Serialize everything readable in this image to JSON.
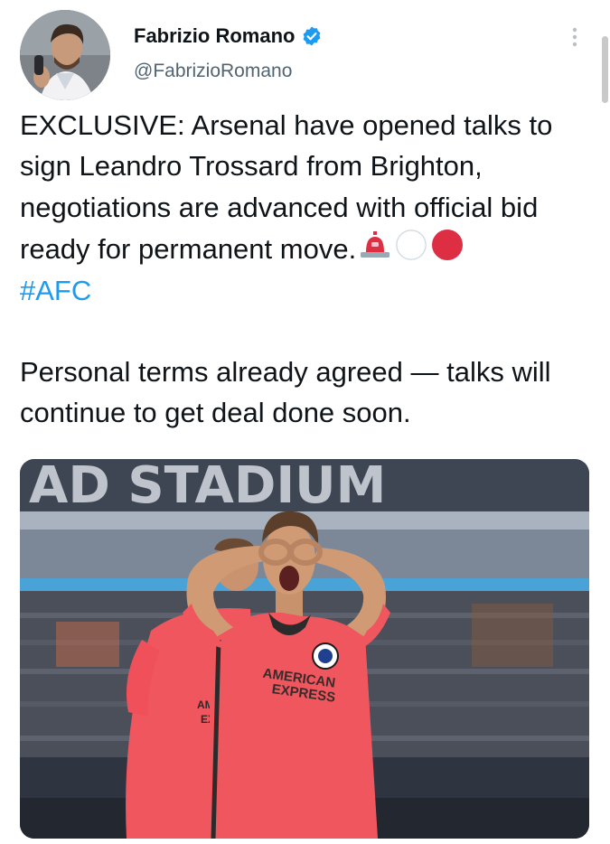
{
  "author": {
    "display_name": "Fabrizio Romano",
    "handle": "@FabrizioRomano",
    "verified": true
  },
  "tweet": {
    "paragraph1": "EXCLUSIVE: Arsenal have opened talks to sign Leandro Trossard from Brighton, negotiations are advanced with official bid ready for permanent move.",
    "emojis": [
      "police-siren-emoji",
      "white-circle-emoji",
      "red-circle-emoji"
    ],
    "hashtag": "#AFC",
    "paragraph2": "Personal terms already agreed — talks will continue to get deal done soon."
  },
  "media": {
    "stadium_sign": "AD STADIUM",
    "shirt_sponsor_line1": "AMERICAN",
    "shirt_sponsor_line2": "EXPRESS",
    "teammate_sponsor_line1": "AM",
    "teammate_sponsor_line2": "EX"
  },
  "colors": {
    "text": "#0f1419",
    "secondary_text": "#536471",
    "link": "#1d9bf0",
    "verified": "#1d9bf0",
    "kit": "#f0565e"
  }
}
